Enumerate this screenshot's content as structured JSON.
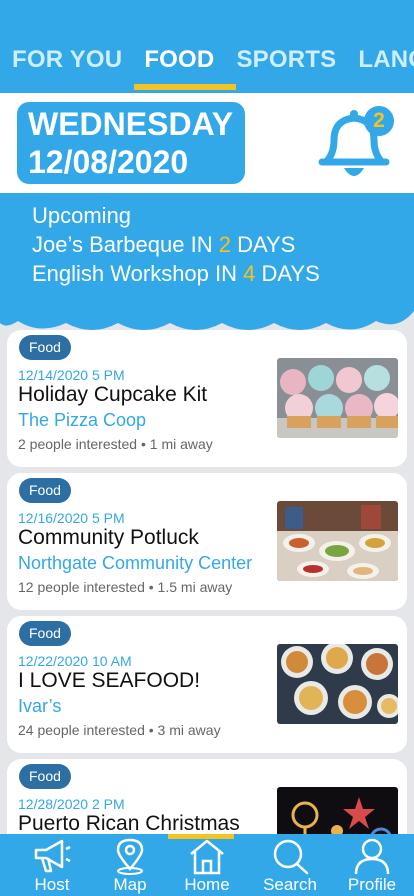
{
  "tabs": [
    {
      "label": "FOR YOU",
      "active": false
    },
    {
      "label": "FOOD",
      "active": true
    },
    {
      "label": "SPORTS",
      "active": false
    },
    {
      "label": "LANGU",
      "active": false
    }
  ],
  "date": {
    "weekday": "WEDNESDAY",
    "date": "12/08/2020"
  },
  "notifications": {
    "count": "2",
    "icon": "bell-icon"
  },
  "upcoming": {
    "heading": "Upcoming",
    "items": [
      {
        "prefix": "Joe’s Barbeque IN ",
        "num": "2",
        "suffix": " DAYS"
      },
      {
        "prefix": "English Workshop IN ",
        "num": "4",
        "suffix": " DAYS"
      }
    ]
  },
  "events": [
    {
      "tag": "Food",
      "datetime": "12/14/2020 5 PM",
      "title": "Holiday Cupcake Kit",
      "location": "The Pizza Coop",
      "meta": "2 people interested • 1 mi away",
      "image": "cupcakes-photo"
    },
    {
      "tag": "Food",
      "datetime": "12/16/2020 5 PM",
      "title": "Community Potluck",
      "location": "Northgate Community Center",
      "meta": "12 people interested • 1.5 mi away",
      "image": "potluck-photo"
    },
    {
      "tag": "Food",
      "datetime": "12/22/2020 10 AM",
      "title": "I LOVE SEAFOOD!",
      "location": "Ivar’s",
      "meta": "24 people interested • 3 mi away",
      "image": "seafood-photo"
    },
    {
      "tag": "Food",
      "datetime": "12/28/2020 2 PM",
      "title": "Puerto Rican Christmas",
      "location": "",
      "meta": "",
      "image": "festival-photo"
    }
  ],
  "bottom_nav": [
    {
      "label": "Host",
      "icon": "megaphone-icon"
    },
    {
      "label": "Map",
      "icon": "map-pin-icon"
    },
    {
      "label": "Home",
      "icon": "home-icon",
      "active": true
    },
    {
      "label": "Search",
      "icon": "search-icon"
    },
    {
      "label": "Profile",
      "icon": "profile-icon"
    }
  ],
  "colors": {
    "primary": "#33a8e8",
    "accent": "#f3c322",
    "badge": "#2d6fa3"
  }
}
